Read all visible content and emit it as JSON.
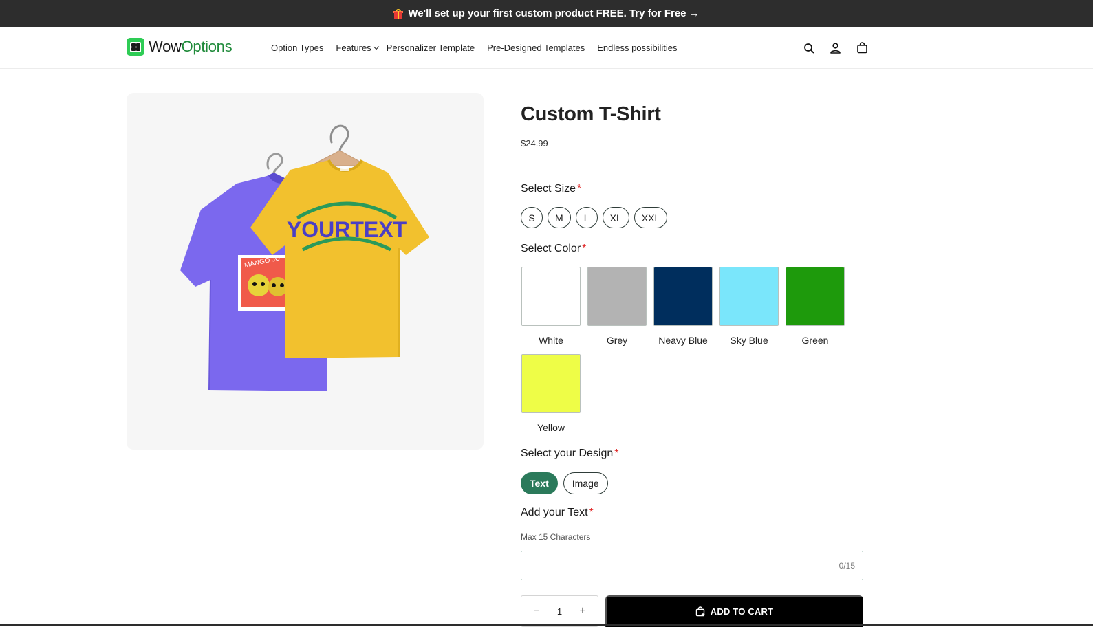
{
  "announcement": {
    "gift_icon": "gift-icon",
    "text": "We'll set up your first custom product FREE. Try for Free →"
  },
  "header": {
    "logo": {
      "part1": "Wow",
      "part2": "Options",
      "icon": "app-grid-icon"
    },
    "nav": [
      {
        "label": "Option Types"
      },
      {
        "label": "Features",
        "has_dropdown": true
      },
      {
        "label": "Personalizer Template"
      },
      {
        "label": "Pre-Designed Templates"
      },
      {
        "label": "Endless possibilities"
      }
    ],
    "icons": [
      "search-icon",
      "account-icon",
      "cart-icon"
    ]
  },
  "product": {
    "title": "Custom T-Shirt",
    "price": "$24.99",
    "size": {
      "label": "Select Size",
      "required": "*",
      "options": [
        "S",
        "M",
        "L",
        "XL",
        "XXL"
      ]
    },
    "color": {
      "label": "Select Color",
      "required": "*",
      "options": [
        {
          "name": "White",
          "hex": "#ffffff"
        },
        {
          "name": "Grey",
          "hex": "#b3b3b3"
        },
        {
          "name": "Neavy Blue",
          "hex": "#002e5d"
        },
        {
          "name": "Sky Blue",
          "hex": "#7ae6fb"
        },
        {
          "name": "Green",
          "hex": "#1e9a0c"
        },
        {
          "name": "Yellow",
          "hex": "#eefd47"
        }
      ]
    },
    "design": {
      "label": "Select your Design",
      "required": "*",
      "options": [
        "Text",
        "Image"
      ],
      "selected": "Text"
    },
    "text": {
      "label": "Add your Text",
      "required": "*",
      "hint": "Max 15 Characters",
      "value": "",
      "counter": "0/15"
    },
    "quantity": {
      "value": "1",
      "minus": "−",
      "plus": "+"
    },
    "add_to_cart": "ADD TO CART"
  },
  "image": {
    "front_shirt_text": "YOURTEXT",
    "back_shirt_text": "MANGO JU",
    "colors": {
      "purple": "#7b68ee",
      "yellow": "#f2c12e",
      "accent_green": "#2b7a5b"
    }
  }
}
